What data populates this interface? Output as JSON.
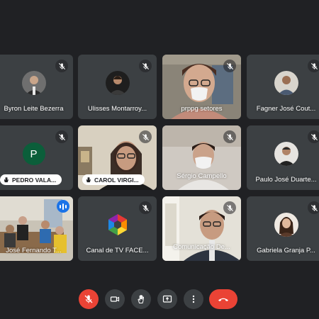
{
  "participants": [
    {
      "name": "Byron Leite Bezerra",
      "muted": true,
      "tile": "avatar"
    },
    {
      "name": "Ulisses Montarroy...",
      "muted": true,
      "tile": "avatar"
    },
    {
      "name": "prppg setores",
      "muted": true,
      "tile": "video"
    },
    {
      "name": "Fagner José Cout...",
      "muted": true,
      "tile": "avatar"
    },
    {
      "name": "PEDRO VALA...",
      "muted": true,
      "tile": "letter",
      "initial": "P",
      "hand_raised": true
    },
    {
      "name": "CAROL VIRGI...",
      "muted": true,
      "tile": "video",
      "hand_raised": true
    },
    {
      "name": "Sérgio Campello",
      "muted": true,
      "tile": "video"
    },
    {
      "name": "Paulo José Duarte...",
      "muted": true,
      "tile": "avatar"
    },
    {
      "name": "José Fernando T...",
      "muted": false,
      "speaking": true,
      "tile": "video"
    },
    {
      "name": "Canal de TV FACE...",
      "muted": true,
      "tile": "avatar"
    },
    {
      "name": "Comunicação De...",
      "muted": true,
      "tile": "video"
    },
    {
      "name": "Gabriela Granja P...",
      "muted": true,
      "tile": "avatar"
    }
  ],
  "controls": [
    "mic-off",
    "camera",
    "raise-hand",
    "present",
    "more",
    "end-call"
  ],
  "colors": {
    "background": "#202124",
    "tile": "#3c4043",
    "danger": "#ea4335",
    "speaking": "#1a73e8",
    "avatar_initial_bg": "#0b5e3a"
  }
}
